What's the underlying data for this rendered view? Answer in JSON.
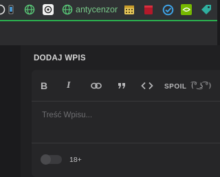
{
  "bookmarks": {
    "items": [
      {
        "icon": "globe-icon-partial"
      },
      {
        "icon": "phone-icon"
      },
      {
        "icon": "globe-icon"
      },
      {
        "icon": "openai-icon"
      },
      {
        "icon": "globe-icon",
        "label": "antycenzor"
      },
      {
        "icon": "calendar-icon"
      },
      {
        "icon": "red-book-icon"
      },
      {
        "icon": "check-circle-icon"
      },
      {
        "icon": "nvidia-icon"
      },
      {
        "icon": "tag-icon"
      }
    ],
    "accent_color": "#2bb14f"
  },
  "form": {
    "title": "DODAJ WPIS",
    "toolbar": {
      "bold": "B",
      "italic": "I",
      "link_icon": "link-icon",
      "quote_icon": "quote-icon",
      "code_icon": "code-icon",
      "spoiler": "SPOIL",
      "lenny": "(͡° ͜ʖ ͡°)"
    },
    "placeholder": "Treść Wpisu...",
    "adult_toggle": {
      "label": "18+",
      "checked": false
    }
  }
}
